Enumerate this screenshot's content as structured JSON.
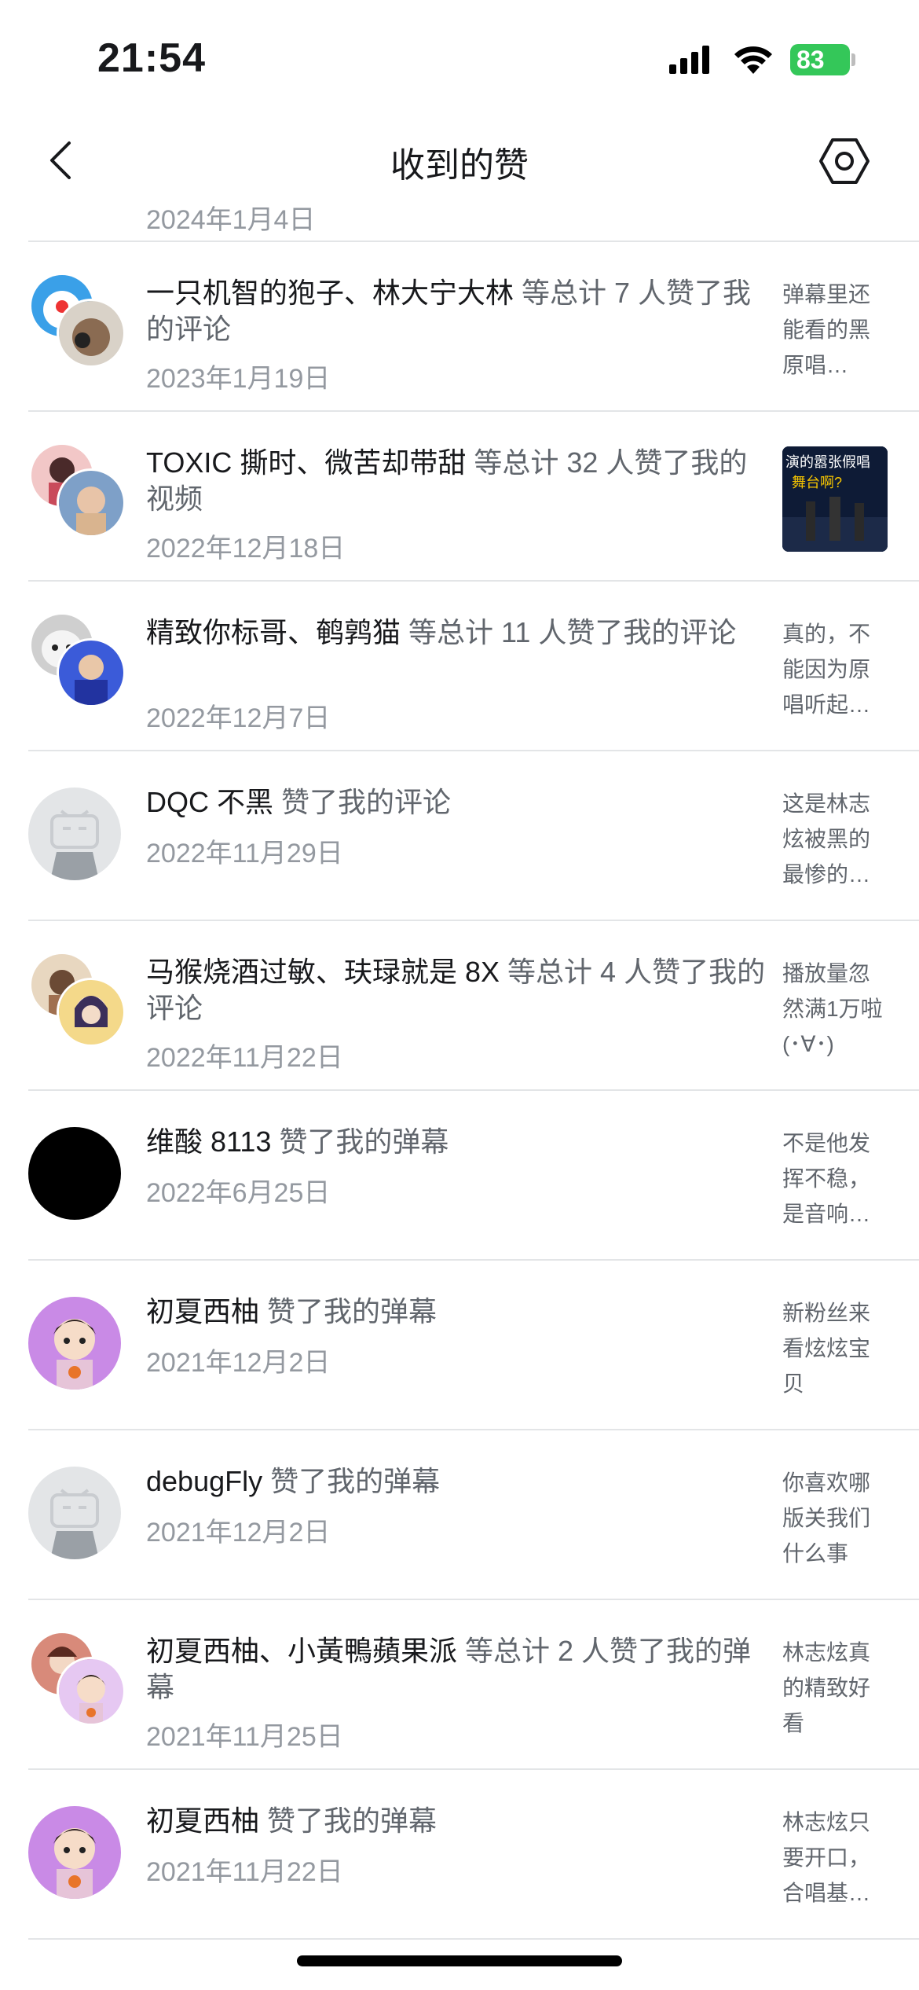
{
  "status": {
    "time": "21:54",
    "battery": "83"
  },
  "header": {
    "title": "收到的赞"
  },
  "partial_date": "2024年1月4日",
  "rows": [
    {
      "names": "一只机智的狍子、林大宁大林",
      "action": " 等总计 7 人赞了我的评论",
      "date": "2023年1月19日",
      "side": "弹幕里还能看的黑原唱…"
    },
    {
      "names": "TOXIC 撕时、微苦却带甜",
      "action": " 等总计 32 人赞了我的视频",
      "date": "2022年12月18日",
      "thumb_line1": "演的嚣张假唱",
      "thumb_line2": "舞台啊?"
    },
    {
      "names": "精致你标哥、鹌鹑猫",
      "action": " 等总计 11 人赞了我的评论",
      "date": "2022年12月7日",
      "side": "真的，不能因为原唱听起…"
    },
    {
      "names": "DQC 不黑",
      "action": " 赞了我的评论",
      "date": "2022年11月29日",
      "side": "这是林志炫被黑的最惨的…"
    },
    {
      "names": "马猴烧酒过敏、玞琭就是 8X",
      "action": " 等总计 4 人赞了我的评论",
      "date": "2022年11月22日",
      "side": "播放量忽然满1万啦 (･∀･)"
    },
    {
      "names": "维酸 8113",
      "action": " 赞了我的弹幕",
      "date": "2022年6月25日",
      "side": "不是他发挥不稳，是音响…"
    },
    {
      "names": "初夏西柚",
      "action": " 赞了我的弹幕",
      "date": "2021年12月2日",
      "side": "新粉丝来看炫炫宝贝"
    },
    {
      "names": "debugFly",
      "action": " 赞了我的弹幕",
      "date": "2021年12月2日",
      "side": "你喜欢哪版关我们什么事"
    },
    {
      "names": "初夏西柚、小黃鴨蘋果派",
      "action": " 等总计 2 人赞了我的弹幕",
      "date": "2021年11月25日",
      "side": "林志炫真的精致好看"
    },
    {
      "names": "初夏西柚",
      "action": " 赞了我的弹幕",
      "date": "2021年11月22日",
      "side": "林志炫只要开口，合唱基…"
    }
  ]
}
